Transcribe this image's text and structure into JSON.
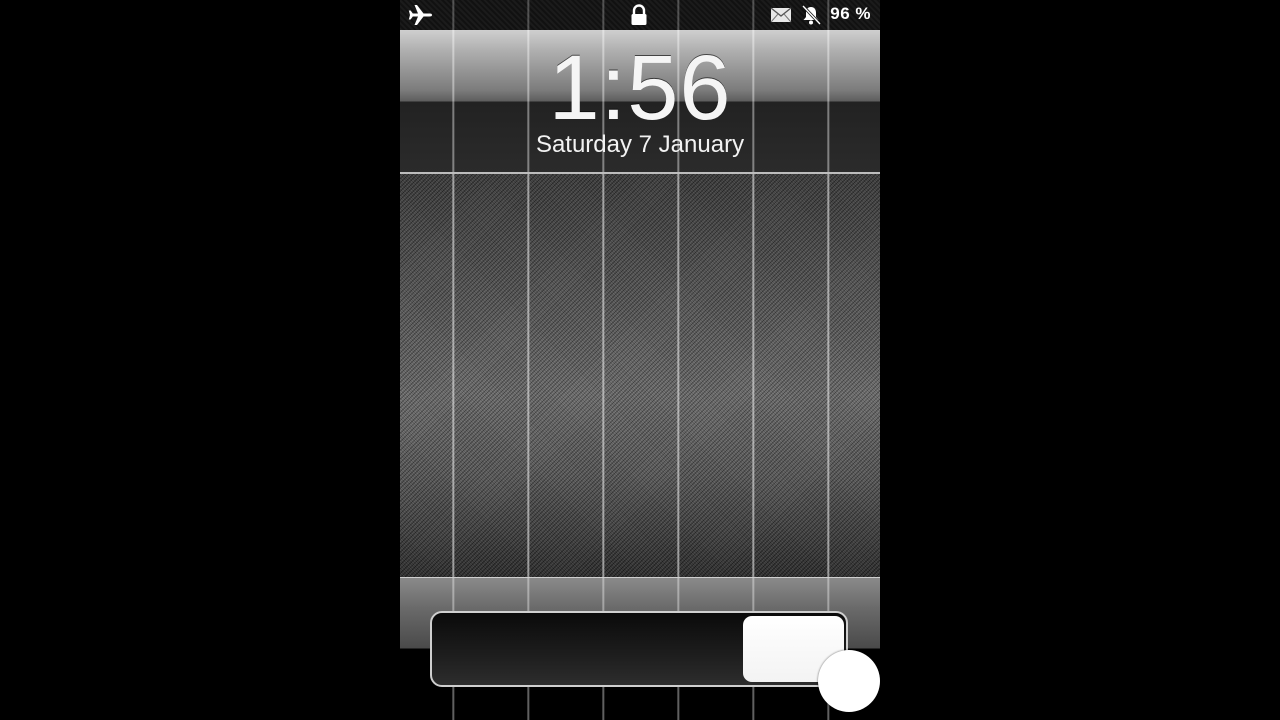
{
  "status_bar": {
    "airplane_icon": "airplane-icon",
    "lock_icon": "lock-icon",
    "mail_icon": "mail-icon",
    "mute_icon": "bell-muted-icon",
    "battery_text": "96 %"
  },
  "lockscreen": {
    "time": "1:56",
    "date": "Saturday 7 January"
  },
  "slider": {
    "label": ""
  },
  "colors": {
    "background": "#000000",
    "text": "#ffffff",
    "knob": "#ffffff"
  }
}
